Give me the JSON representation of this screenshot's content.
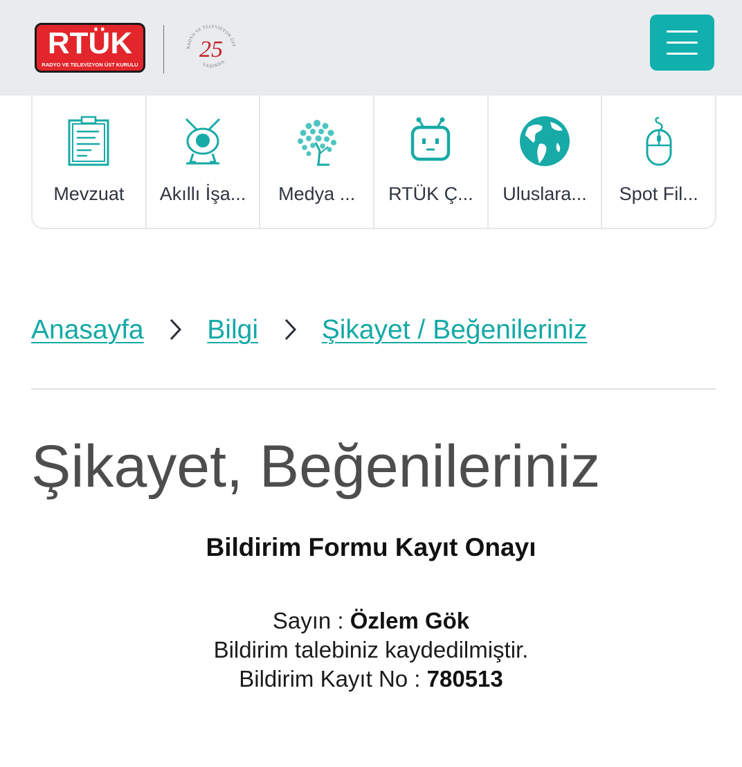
{
  "header": {
    "logo_text": "RTÜK",
    "logo_subtext": "RADYO VE TELEVİZYON ÜST KURULU",
    "anniversary": {
      "number": "25",
      "ring_text": "RADYO VE TELEVİZYON ÜST KURULU",
      "bottom_text": "YAŞINDA"
    },
    "menu_icon": "hamburger-icon",
    "accent_color": "#11b0ad"
  },
  "quick_nav": {
    "items": [
      {
        "label": "Mevzuat",
        "icon": "clipboard-icon"
      },
      {
        "label": "Akıllı İşa...",
        "icon": "smart-tv-icon"
      },
      {
        "label": "Medya ...",
        "icon": "media-tree-icon"
      },
      {
        "label": "RTÜK Ç...",
        "icon": "robot-tv-icon"
      },
      {
        "label": "Uluslara...",
        "icon": "globe-icon"
      },
      {
        "label": "Spot Fil...",
        "icon": "mouse-icon"
      }
    ]
  },
  "breadcrumb": {
    "items": [
      {
        "label": "Anasayfa"
      },
      {
        "label": "Bilgi"
      },
      {
        "label": "Şikayet / Beğenileriniz"
      }
    ]
  },
  "page_title": "Şikayet, Beğenileriniz",
  "form": {
    "heading": "Bildirim Formu Kayıt Onayı",
    "greeting_label": "Sayın : ",
    "name": "Özlem Gök",
    "message": "Bildirim talebiniz kaydedilmiştir.",
    "record_label": "Bildirim Kayıt No : ",
    "record_no": "780513"
  }
}
